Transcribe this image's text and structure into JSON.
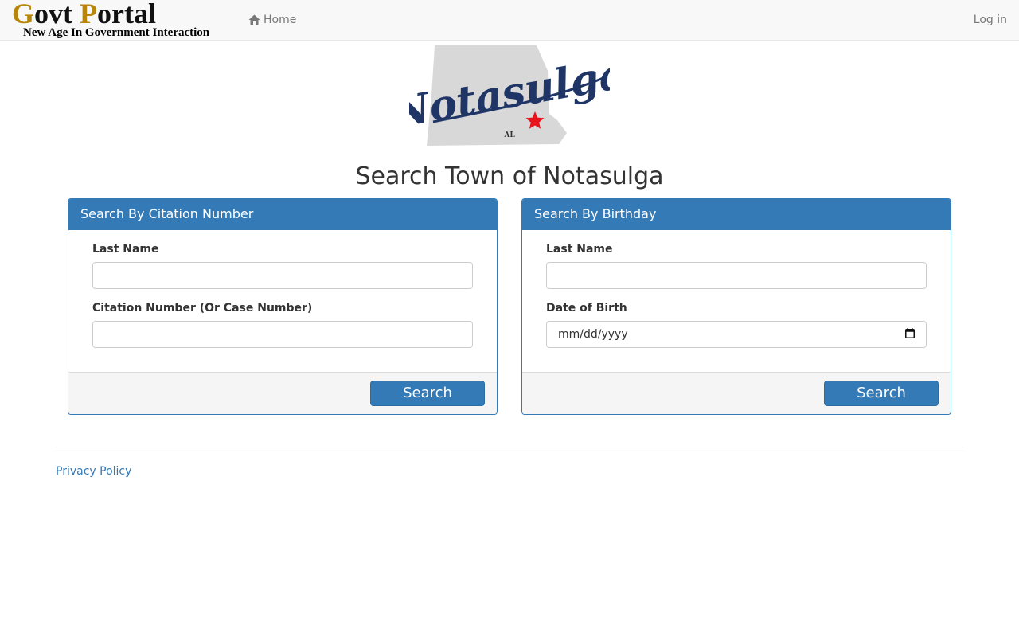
{
  "navbar": {
    "brand": {
      "title_parts": [
        "G",
        "ovt ",
        "P",
        "ortal"
      ],
      "tagline": "New Age In Government Interaction",
      "accent_color": "#b8860b"
    },
    "home_icon": "home-icon",
    "home_label": "Home",
    "login_label": "Log in"
  },
  "logo": {
    "script_text": "Notasulga",
    "state_abbr": "AL",
    "star_icon": "star-icon",
    "script_color": "#1f3566",
    "star_color": "#e8141b"
  },
  "page_title": "Search Town of Notasulga",
  "panels": [
    {
      "heading": "Search By Citation Number",
      "fields": [
        {
          "label": "Last Name",
          "value": "",
          "placeholder": ""
        },
        {
          "label": "Citation Number (Or Case Number)",
          "value": "",
          "placeholder": ""
        }
      ],
      "button": "Search"
    },
    {
      "heading": "Search By Birthday",
      "fields": [
        {
          "label": "Last Name",
          "value": "",
          "placeholder": ""
        },
        {
          "label": "Date of Birth",
          "value": "",
          "placeholder": "mm/dd/yyyy",
          "icon": "calendar-icon"
        }
      ],
      "button": "Search"
    }
  ],
  "footer": {
    "privacy_label": "Privacy Policy"
  },
  "colors": {
    "primary": "#337ab7",
    "nav_bg": "#f8f8f8",
    "panel_footer_bg": "#f5f5f5"
  }
}
